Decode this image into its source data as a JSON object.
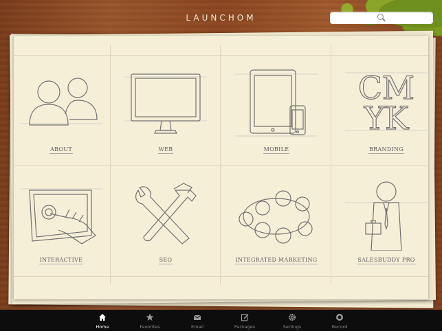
{
  "header": {
    "brand": "LAUNCHOM",
    "search_placeholder": ""
  },
  "grid": {
    "items": [
      {
        "label": "ABOUT",
        "icon": "people-icon"
      },
      {
        "label": "WEB",
        "icon": "monitor-icon"
      },
      {
        "label": "MOBILE",
        "icon": "tablet-phone-icon"
      },
      {
        "label": "BRANDING",
        "icon": "cmyk-icon"
      },
      {
        "label": "INTERACTIVE",
        "icon": "touchscreen-icon"
      },
      {
        "label": "SEO",
        "icon": "tools-icon"
      },
      {
        "label": "INTEGRATED MARKETING",
        "icon": "meeting-table-icon"
      },
      {
        "label": "SALESBUDDY PRO",
        "icon": "salesman-icon"
      }
    ]
  },
  "tabbar": {
    "tabs": [
      {
        "label": "Home",
        "icon": "home-icon",
        "active": true
      },
      {
        "label": "Favorites",
        "icon": "star-icon",
        "active": false
      },
      {
        "label": "Email",
        "icon": "email-icon",
        "active": false
      },
      {
        "label": "Packages",
        "icon": "packages-icon",
        "active": false
      },
      {
        "label": "Settings",
        "icon": "gear-icon",
        "active": false
      },
      {
        "label": "Record",
        "icon": "record-icon",
        "active": false
      }
    ]
  },
  "colors": {
    "wood": "#8b4620",
    "paper": "#f6efd8",
    "tabbar": "#0d0d0d",
    "accent_green": "#6f8f1e"
  }
}
